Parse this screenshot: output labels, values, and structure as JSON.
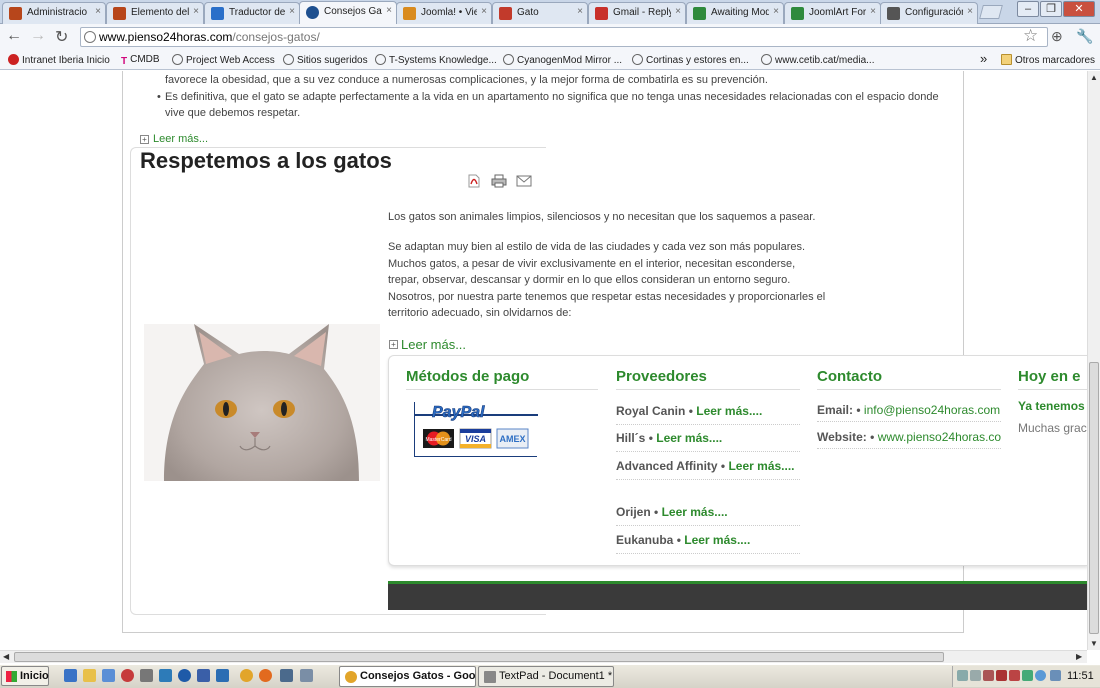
{
  "browser": {
    "tabs": [
      {
        "title": "Administracio",
        "color": "#b7461b",
        "active": false
      },
      {
        "title": "Elemento del",
        "color": "#b7461b",
        "active": false
      },
      {
        "title": "Traductor de",
        "color": "#2a6fc9",
        "active": false
      },
      {
        "title": "Consejos Gat",
        "color": "#1d4f8f",
        "active": true
      },
      {
        "title": "Joomla! • Vie",
        "color": "#d98b1f",
        "active": false
      },
      {
        "title": "Gato",
        "color": "#c23a2b",
        "active": false
      },
      {
        "title": "Gmail - Reply",
        "color": "#c8302a",
        "active": false
      },
      {
        "title": "Awaiting Mod",
        "color": "#2f8a3d",
        "active": false
      },
      {
        "title": "JoomlArt For",
        "color": "#2f8a3d",
        "active": false
      },
      {
        "title": "Configuración",
        "color": "#555555",
        "active": false
      }
    ],
    "tab_close_glyph": "×",
    "url_host": "www.pienso24horas.com",
    "url_path": "/consejos-gatos/",
    "bookmarks": [
      {
        "label": "Intranet Iberia Inicio",
        "icon": "iberia-icon"
      },
      {
        "label": "CMDB",
        "icon": "telekom-icon"
      },
      {
        "label": "Project Web Access",
        "icon": "globe-icon"
      },
      {
        "label": "Sitios sugeridos",
        "icon": "globe-icon"
      },
      {
        "label": "T-Systems Knowledge...",
        "icon": "globe-icon"
      },
      {
        "label": "CyanogenMod Mirror ...",
        "icon": "globe-icon"
      },
      {
        "label": "Cortinas y estores en...",
        "icon": "globe-icon"
      },
      {
        "label": "www.cetib.cat/media...",
        "icon": "globe-icon"
      }
    ],
    "bookmarks_overflow": "»",
    "other_bookmarks": "Otros marcadores"
  },
  "article_prev": {
    "bullet1_tail": "favorece la obesidad, que a su vez conduce a numerosas complicaciones, y la mejor forma de combatirla es su prevención.",
    "bullet2": "Es definitiva, que el gato se adapte perfectamente a la vida en un apartamento no significa que no tenga unas necesidades relacionadas con el espacio donde vive que debemos respetar.",
    "read_more": "Leer más..."
  },
  "article": {
    "title": "Respetemos a los gatos",
    "para1": "Los gatos son animales limpios, silenciosos y no necesitan que los saquemos a pasear.",
    "para2": "Se adaptan muy bien al estilo de vida de las ciudades y cada vez son más populares. Muchos gatos, a pesar de vivir exclusivamente en el interior, necesitan esconderse, trepar, observar, descansar y dormir en lo que ellos consideran un entorno seguro. Nosotros, por nuestra parte tenemos que respetar estas necesidades y proporcionarles el territorio adecuado, sin olvidarnos de:",
    "read_more": "Leer más..."
  },
  "footer": {
    "payment_title": "Métodos de pago",
    "paypal_label": "PayPal",
    "cards": [
      "MasterCard",
      "VISA",
      "AMEX"
    ],
    "providers_title": "Proveedores",
    "providers": [
      {
        "name": "Royal Canin",
        "link": "Leer más...."
      },
      {
        "name": "Hill´s",
        "link": "Leer más...."
      },
      {
        "name": "Advanced Affinity",
        "link": "Leer más...."
      },
      {
        "name": "Orijen",
        "link": "Leer más...."
      },
      {
        "name": "Eukanuba",
        "link": "Leer más...."
      }
    ],
    "separator": "•",
    "contact_title": "Contacto",
    "email_label": "Email:",
    "email_value": "info@pienso24horas.com",
    "website_label": "Website:",
    "website_value": "www.pienso24horas.com",
    "today_title": "Hoy en e",
    "today_sub": "Ya tenemos",
    "today_text": "Muchas grac nosotros."
  },
  "taskbar": {
    "start": "Inicio",
    "tasks": [
      {
        "label": "Consejos Gatos - Goo...",
        "active": true
      },
      {
        "label": "TextPad - Document1 *",
        "active": false
      }
    ],
    "clock": "11:51"
  },
  "colors": {
    "accent_green": "#2d8a2d",
    "footer_bar": "#3a3a3a"
  }
}
